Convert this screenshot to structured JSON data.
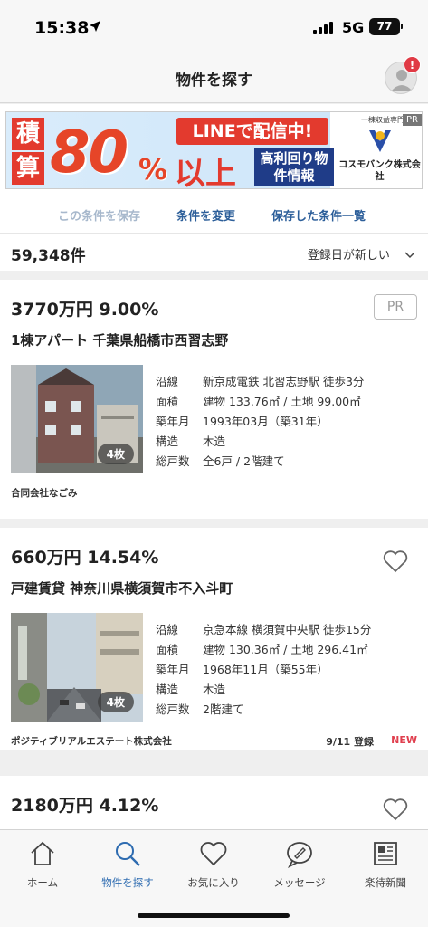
{
  "status_bar": {
    "time": "15:38",
    "network": "5G",
    "battery": "77"
  },
  "header": {
    "title": "物件を探す",
    "badge": "!"
  },
  "banner": {
    "char1": "積",
    "char2": "算",
    "big_number": "80",
    "percent": "%",
    "line_text": "LINEで配信中!",
    "ijou": "以上",
    "sub_text": "高利回り物件情報",
    "tag": "一棟収益専門",
    "pr": "PR",
    "company": "コスモバンク株式会社"
  },
  "actions": {
    "save": "この条件を保存",
    "change": "条件を変更",
    "saved_list": "保存した条件一覧"
  },
  "results": {
    "count": "59,348件",
    "sort": "登録日が新しい"
  },
  "listings": [
    {
      "price": "3770万円 9.00%",
      "title": "1棟アパート 千葉県船橋市西習志野",
      "pr": "PR",
      "photo_count": "4枚",
      "specs": [
        {
          "label": "沿線",
          "value": "新京成電鉄 北習志野駅 徒歩3分"
        },
        {
          "label": "面積",
          "value": "建物 133.76㎡ / 土地 99.00㎡"
        },
        {
          "label": "築年月",
          "value": "1993年03月（築31年）"
        },
        {
          "label": "構造",
          "value": "木造"
        },
        {
          "label": "総戸数",
          "value": "全6戸 / 2階建て"
        }
      ],
      "agent": "合同会社なごみ"
    },
    {
      "price": "660万円 14.54%",
      "title": "戸建賃貸 神奈川県横須賀市不入斗町",
      "photo_count": "4枚",
      "specs": [
        {
          "label": "沿線",
          "value": "京急本線 横須賀中央駅 徒歩15分"
        },
        {
          "label": "面積",
          "value": "建物 130.36㎡ / 土地 296.41㎡"
        },
        {
          "label": "築年月",
          "value": "1968年11月（築55年）"
        },
        {
          "label": "構造",
          "value": "木造"
        },
        {
          "label": "総戸数",
          "value": "2階建て"
        }
      ],
      "agent": "ポジティブリアルエステート株式会社",
      "date": "9/11 登録",
      "new_label": "NEW"
    },
    {
      "price": "2180万円 4.12%"
    }
  ],
  "tabs": [
    {
      "label": "ホーム",
      "icon": "home-icon"
    },
    {
      "label": "物件を探す",
      "icon": "search-icon",
      "active": true
    },
    {
      "label": "お気に入り",
      "icon": "heart-icon"
    },
    {
      "label": "メッセージ",
      "icon": "message-icon"
    },
    {
      "label": "楽待新聞",
      "icon": "newspaper-icon"
    }
  ],
  "colors": {
    "accent": "#2d6bb0",
    "badge": "#e03a45",
    "new": "#e0404f",
    "link": "#2d5f9a"
  }
}
